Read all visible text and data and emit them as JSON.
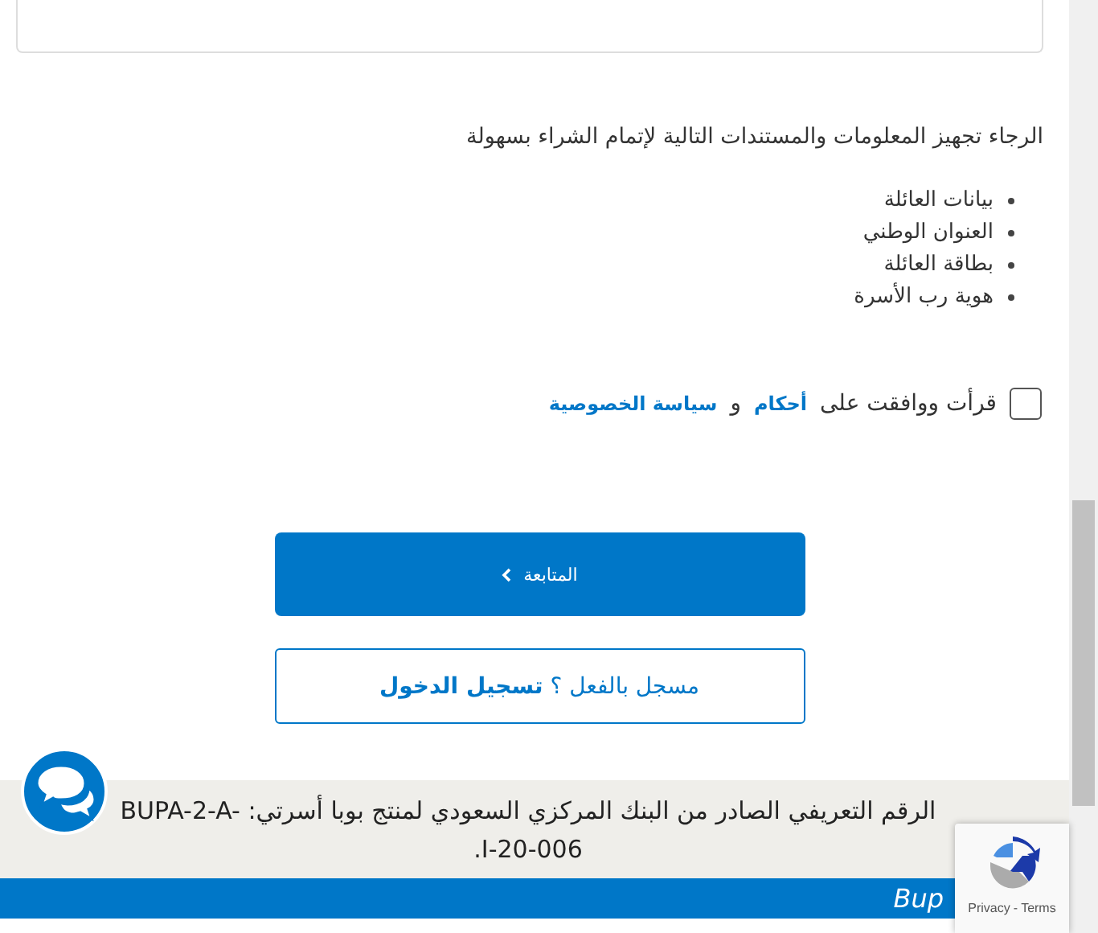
{
  "intro": "الرجاء تجهيز المعلومات والمستندات التالية لإتمام الشراء بسهولة",
  "documents": [
    "بيانات العائلة",
    "العنوان الوطني",
    "بطاقة العائلة",
    "هوية رب الأسرة"
  ],
  "agreement": {
    "checked": false,
    "text": "قرأت ووافقت على",
    "terms_link": "أحكام",
    "conjunction": "و",
    "privacy_link": "سياسة الخصوصية"
  },
  "continue_button": {
    "label": "المتابعة"
  },
  "login_button": {
    "label": "مسجل بالفعل ؟ **تسجيل الدخول**"
  },
  "footer": {
    "license_text": "الرقم التعريفي الصادر من البنك المركزي السعودي لمنتج بوبا أسرتي: BUPA-2-A-I-20-006.",
    "brand": "Bup"
  },
  "recaptcha": {
    "privacy": "Privacy",
    "separator": "-",
    "terms": "Terms"
  }
}
